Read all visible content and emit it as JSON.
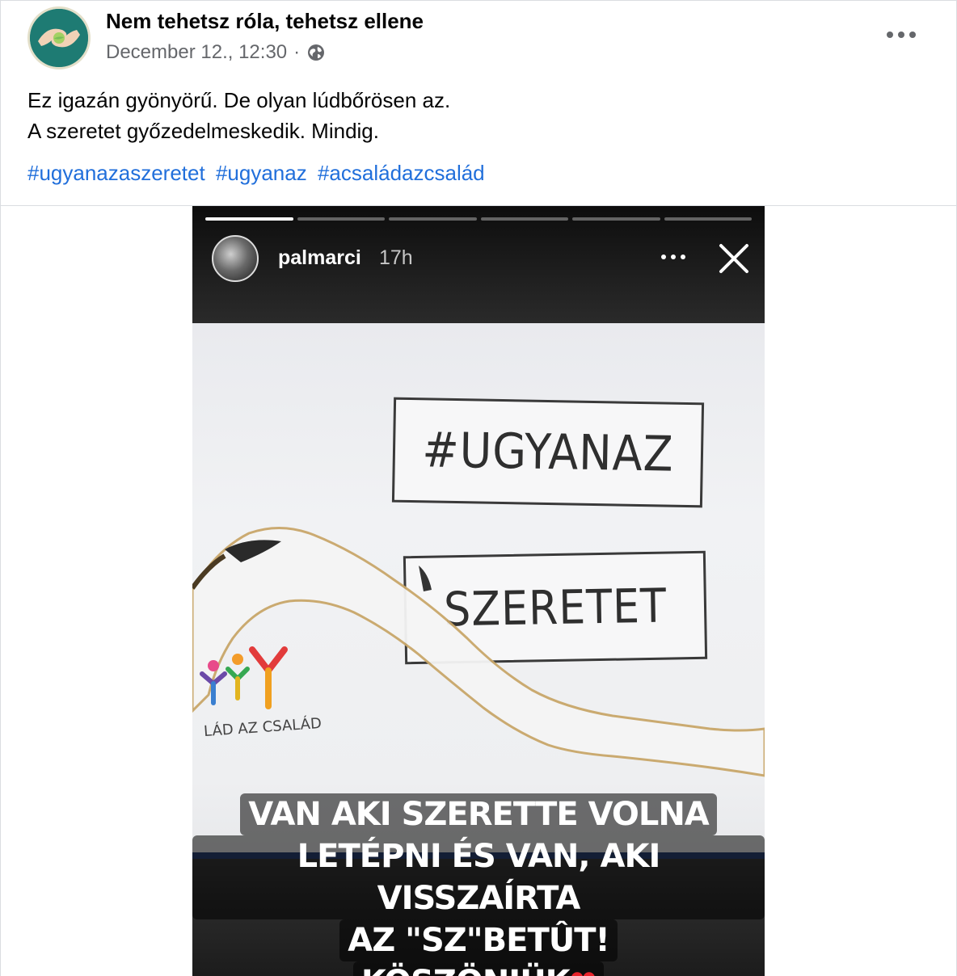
{
  "post": {
    "page_name": "Nem tehetsz róla, tehetsz ellene",
    "date": "December 12., 12:30",
    "separator": "·",
    "audience_icon": "globe-icon",
    "more_icon": "more-horizontal-icon",
    "text_lines": [
      "Ez igazán gyönyörű. De olyan lúdbőrösen az.",
      "A szeretet győzedelmeskedik. Mindig."
    ],
    "hashtags": [
      "#ugyanazaszeretet",
      "#ugyanaz",
      "#acsaládazcsalád"
    ]
  },
  "story": {
    "progress_segments": 6,
    "active_segment": 1,
    "username": "palmarci",
    "time": "17h",
    "close_icon": "close-icon",
    "sign_top": "#UGYANAZ",
    "sign_bottom": "SZERETET",
    "logo_text": "LÁD AZ CSALÁD",
    "caption_lines": [
      "VAN AKI SZERETTE VOLNA",
      "LETÉPNI ÉS VAN, AKI VISSZAÍRTA",
      "AZ \"SZ\"BETÛT!",
      "KÖSZÖNJÜK"
    ],
    "caption_emoji": "❤"
  },
  "colors": {
    "link": "#216fdb",
    "meta_text": "#65676b",
    "avatar_bg": "#1e7b73",
    "board_trim": "#2c4476"
  }
}
